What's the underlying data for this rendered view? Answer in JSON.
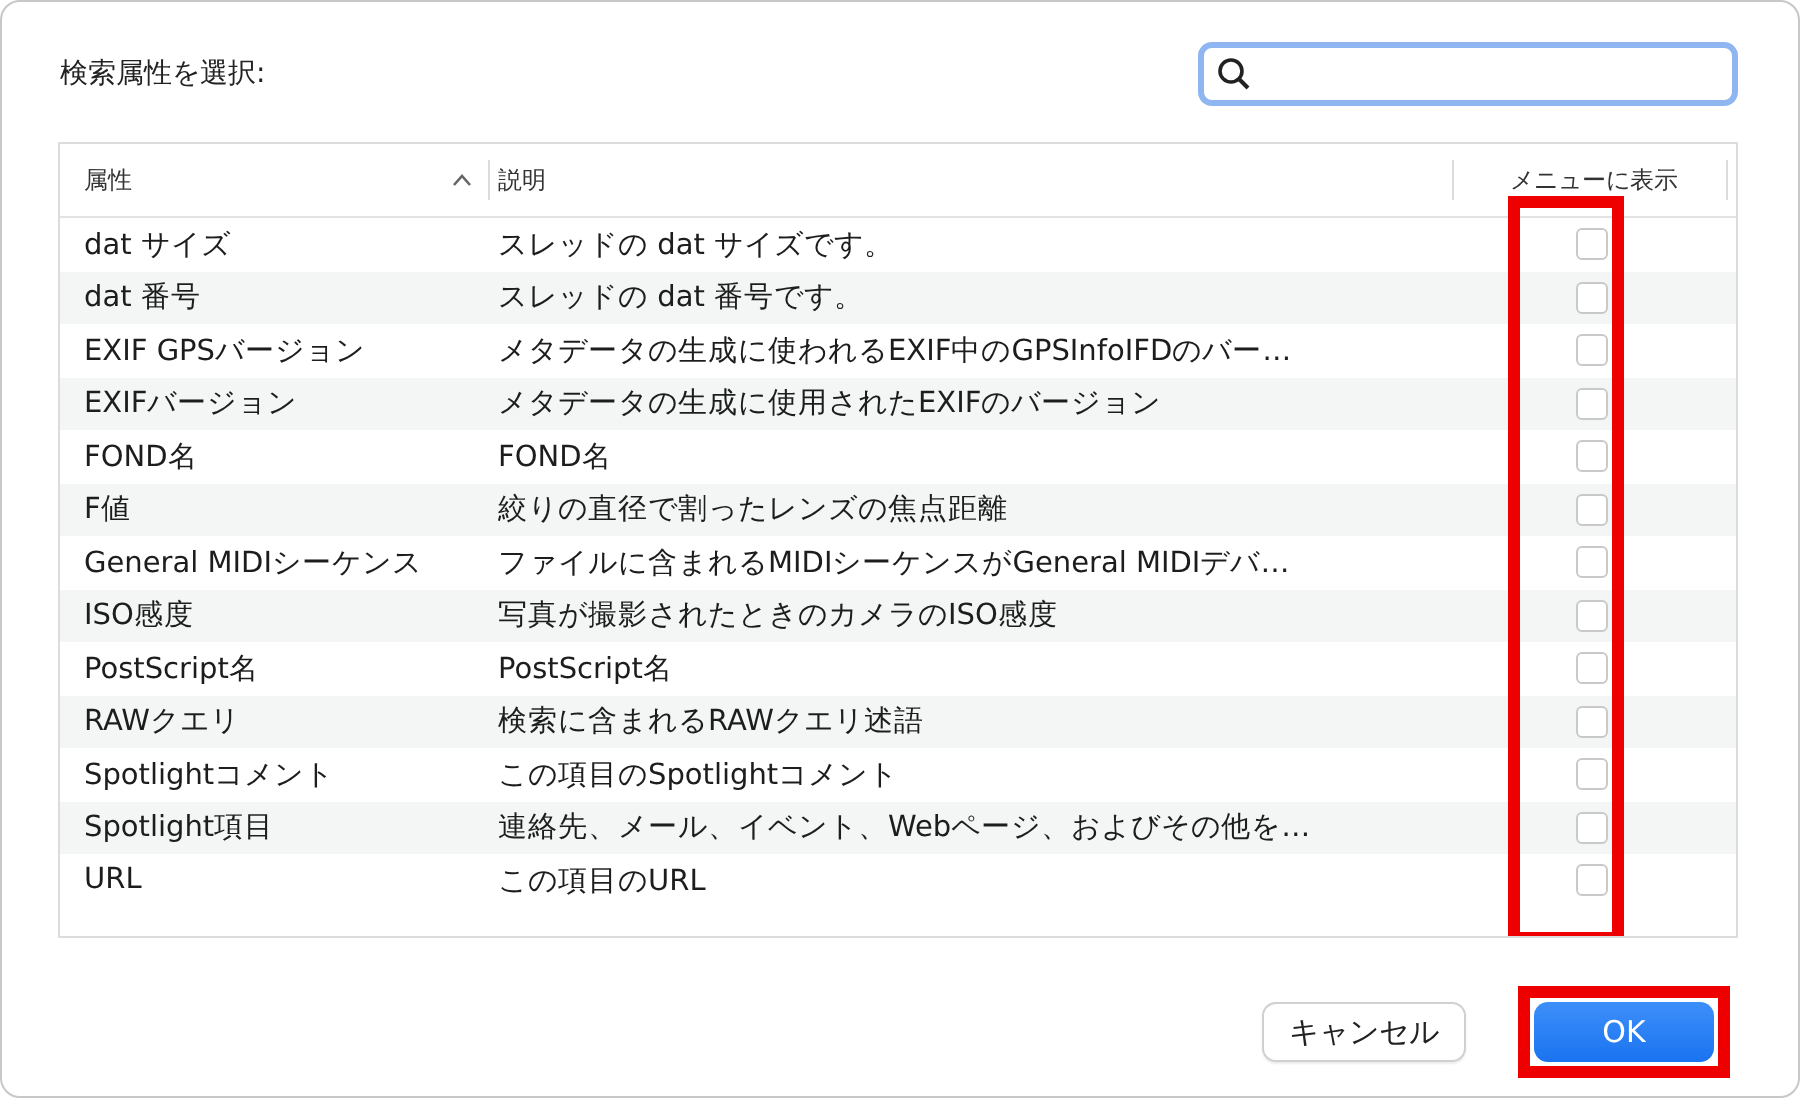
{
  "prompt": "検索属性を選択:",
  "table": {
    "columns": [
      {
        "label": "属性",
        "sorted": true
      },
      {
        "label": "説明",
        "sorted": false
      },
      {
        "label": "メニューに表示",
        "sorted": false
      }
    ],
    "rows": [
      {
        "attribute": "dat サイズ",
        "description": "スレッドの dat サイズです。",
        "checked": false
      },
      {
        "attribute": "dat 番号",
        "description": "スレッドの dat 番号です。",
        "checked": false
      },
      {
        "attribute": "EXIF GPSバージョン",
        "description": "メタデータの生成に使われるEXIF中のGPSInfoIFDのバー…",
        "checked": false
      },
      {
        "attribute": "EXIFバージョン",
        "description": "メタデータの生成に使用されたEXIFのバージョン",
        "checked": false
      },
      {
        "attribute": "FOND名",
        "description": "FOND名",
        "checked": false
      },
      {
        "attribute": "F値",
        "description": "絞りの直径で割ったレンズの焦点距離",
        "checked": false
      },
      {
        "attribute": "General MIDIシーケンス",
        "description": "ファイルに含まれるMIDIシーケンスがGeneral MIDIデバ…",
        "checked": false
      },
      {
        "attribute": "ISO感度",
        "description": "写真が撮影されたときのカメラのISO感度",
        "checked": false
      },
      {
        "attribute": "PostScript名",
        "description": "PostScript名",
        "checked": false
      },
      {
        "attribute": "RAWクエリ",
        "description": "検索に含まれるRAWクエリ述語",
        "checked": false
      },
      {
        "attribute": "Spotlightコメント",
        "description": "この項目のSpotlightコメント",
        "checked": false
      },
      {
        "attribute": "Spotlight項目",
        "description": "連絡先、メール、イベント、Webページ、およびその他を…",
        "checked": false
      },
      {
        "attribute": "URL",
        "description": "この項目のURL",
        "checked": false
      }
    ]
  },
  "highlights": {
    "checkbox_column": true,
    "ok_button": true
  },
  "buttons": [
    {
      "label": "キャンセル",
      "kind": "secondary"
    },
    {
      "label": "OK",
      "kind": "primary"
    }
  ]
}
